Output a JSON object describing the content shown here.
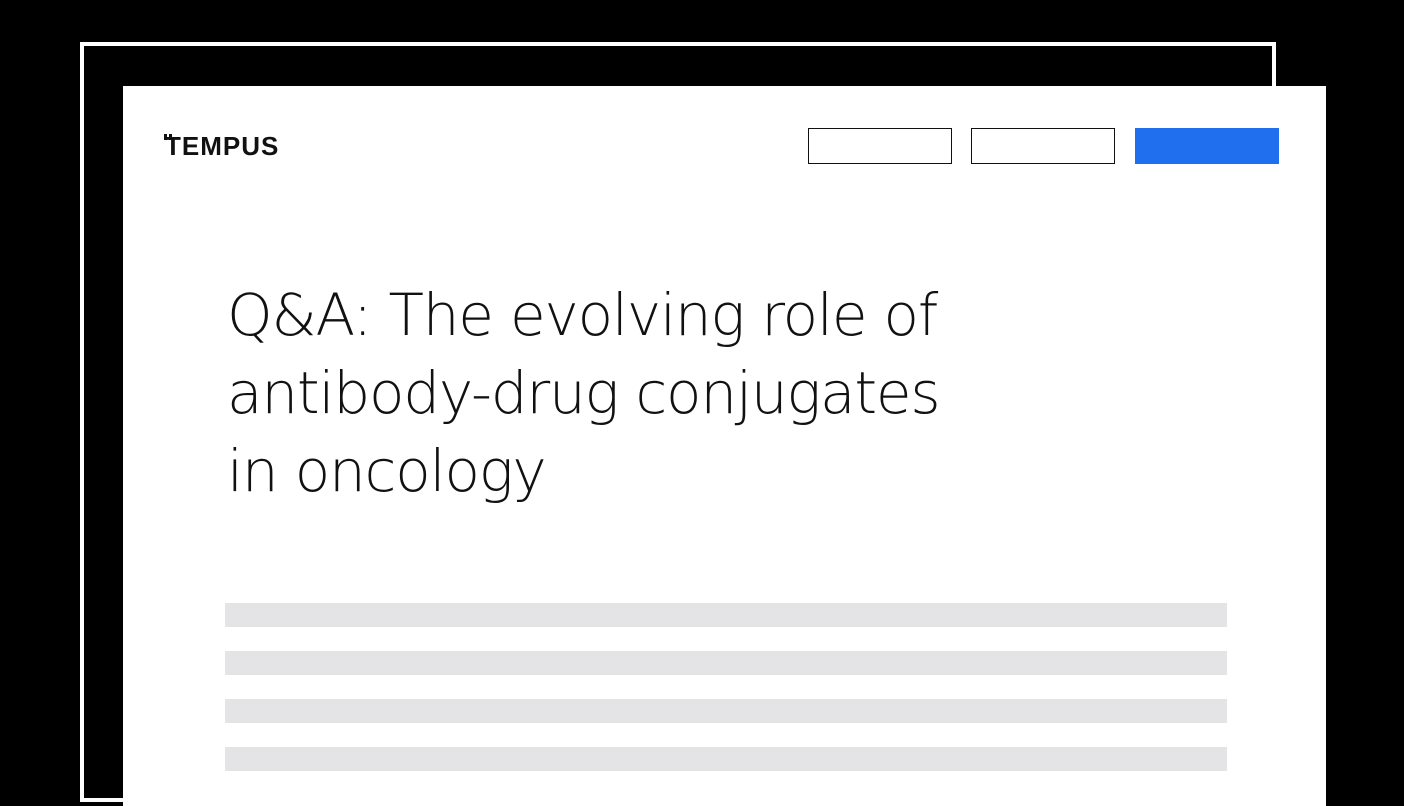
{
  "header": {
    "logo_text": "EMPUS",
    "logo_full": "TEMPUS",
    "logo_mark": "tempus-double-tick-mark",
    "nav_buttons": [
      {
        "label": "",
        "style": "outline"
      },
      {
        "label": "",
        "style": "outline"
      },
      {
        "label": "",
        "style": "primary",
        "color": "#1f6fef"
      }
    ]
  },
  "article": {
    "title_lines": [
      "Q&A: The evolving role of",
      "antibody-drug conjugates",
      "in oncology"
    ],
    "placeholder_line_count": 4
  },
  "colors": {
    "background": "#000000",
    "card": "#ffffff",
    "accent": "#1f6fef",
    "placeholder": "#e4e4e7",
    "text": "#111111"
  }
}
